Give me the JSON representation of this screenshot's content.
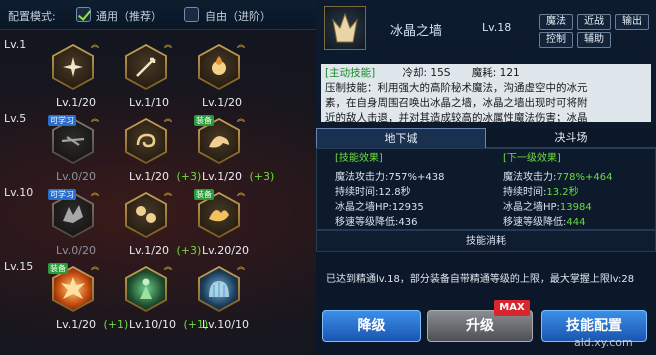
{
  "config": {
    "label": "配置模式:",
    "mode_general": "通用（推荐）",
    "mode_free": "自由（进阶）",
    "general_checked": true,
    "free_checked": false
  },
  "tree": {
    "levels": [
      "Lv.1",
      "Lv.5",
      "Lv.10",
      "Lv.15"
    ],
    "rows": [
      [
        {
          "icon": "star-burst-icon",
          "level": "Lv.1/20",
          "bonus": "",
          "badge": "",
          "dim": false,
          "style": "gold"
        },
        {
          "icon": "spear-icon",
          "level": "Lv.1/10",
          "bonus": "",
          "badge": "",
          "dim": false,
          "style": "gold"
        },
        {
          "icon": "fire-orb-icon",
          "level": "Lv.1/20",
          "bonus": "",
          "badge": "",
          "dim": false,
          "style": "gold"
        }
      ],
      [
        {
          "icon": "ice-shard-icon",
          "level": "Lv.0/20",
          "bonus": "",
          "badge": "可学习",
          "dim": true,
          "style": "gold"
        },
        {
          "icon": "swirl-icon",
          "level": "Lv.1/20",
          "bonus": "(+3)",
          "badge": "",
          "dim": false,
          "style": "gold"
        },
        {
          "icon": "dragon-icon",
          "level": "Lv.1/20",
          "bonus": "(+3)",
          "badge": "装备",
          "dim": false,
          "style": "gold"
        }
      ],
      [
        {
          "icon": "wing-icon",
          "level": "Lv.0/20",
          "bonus": "",
          "badge": "可学习",
          "dim": true,
          "style": "gold"
        },
        {
          "icon": "orbs-icon",
          "level": "Lv.1/20",
          "bonus": "(+3)",
          "badge": "",
          "dim": false,
          "style": "gold"
        },
        {
          "icon": "flame-beast-icon",
          "level": "Lv.20/20",
          "bonus": "",
          "badge": "装备",
          "dim": false,
          "style": "gold"
        }
      ],
      [
        {
          "icon": "explosion-icon",
          "level": "Lv.1/20",
          "bonus": "(+1)",
          "badge": "装备",
          "dim": false,
          "style": "fire"
        },
        {
          "icon": "green-mage-icon",
          "level": "Lv.10/10",
          "bonus": "(+1)",
          "badge": "",
          "dim": false,
          "style": "green"
        },
        {
          "icon": "ice-dome-icon",
          "level": "Lv.10/10",
          "bonus": "",
          "badge": "",
          "dim": false,
          "style": "ice"
        }
      ]
    ]
  },
  "skill": {
    "icon": "ice-wall-icon",
    "name": "冰晶之墙",
    "level": "Lv.18",
    "tags": [
      "魔法",
      "近战",
      "输出",
      "控制",
      "辅助"
    ],
    "active_tag": "[主动技能]",
    "cooldown": "冷却:  15S",
    "mana": "魔耗:  121",
    "desc_lines": [
      "压制技能：利用强大的高阶秘术魔法，沟通虚空中的冰元",
      "素，在自身周围召唤出冰晶之墙，冰晶之墙出现时可将附",
      "近的敌人击退，并对其造成较高的冰属性魔法伤害；冰晶"
    ]
  },
  "tabs": {
    "dungeon": "地下城",
    "arena": "决斗场"
  },
  "effects": {
    "current_header": "[技能效果]",
    "next_header": "[下一级效果]",
    "current": [
      {
        "label": "魔法攻击力:",
        "value": "757%+438"
      },
      {
        "label": "持续时间:",
        "value": "12.8秒"
      },
      {
        "label": "冰晶之墙HP:",
        "value": "12935"
      },
      {
        "label": "移速等级降低:",
        "value": "436"
      }
    ],
    "next": [
      {
        "label": "魔法攻击力:",
        "value": "778%+464"
      },
      {
        "label": "持续时间:",
        "value": "13.2秒"
      },
      {
        "label": "冰晶之墙HP:",
        "value": "13984"
      },
      {
        "label": "移速等级降低:",
        "value": "444"
      }
    ]
  },
  "cost_header": "技能消耗",
  "max_info": "已达到精通lv.18，部分装备自带精通等级的上限，最大掌握上限lv:28",
  "buttons": {
    "down": "降级",
    "up": "升级",
    "max": "MAX",
    "config": "技能配置"
  },
  "watermark": "ald.xy.com",
  "colors": {
    "accent_blue": "#2f7fe0",
    "bonus_green": "#6ddc3c",
    "max_red": "#d7262c"
  }
}
